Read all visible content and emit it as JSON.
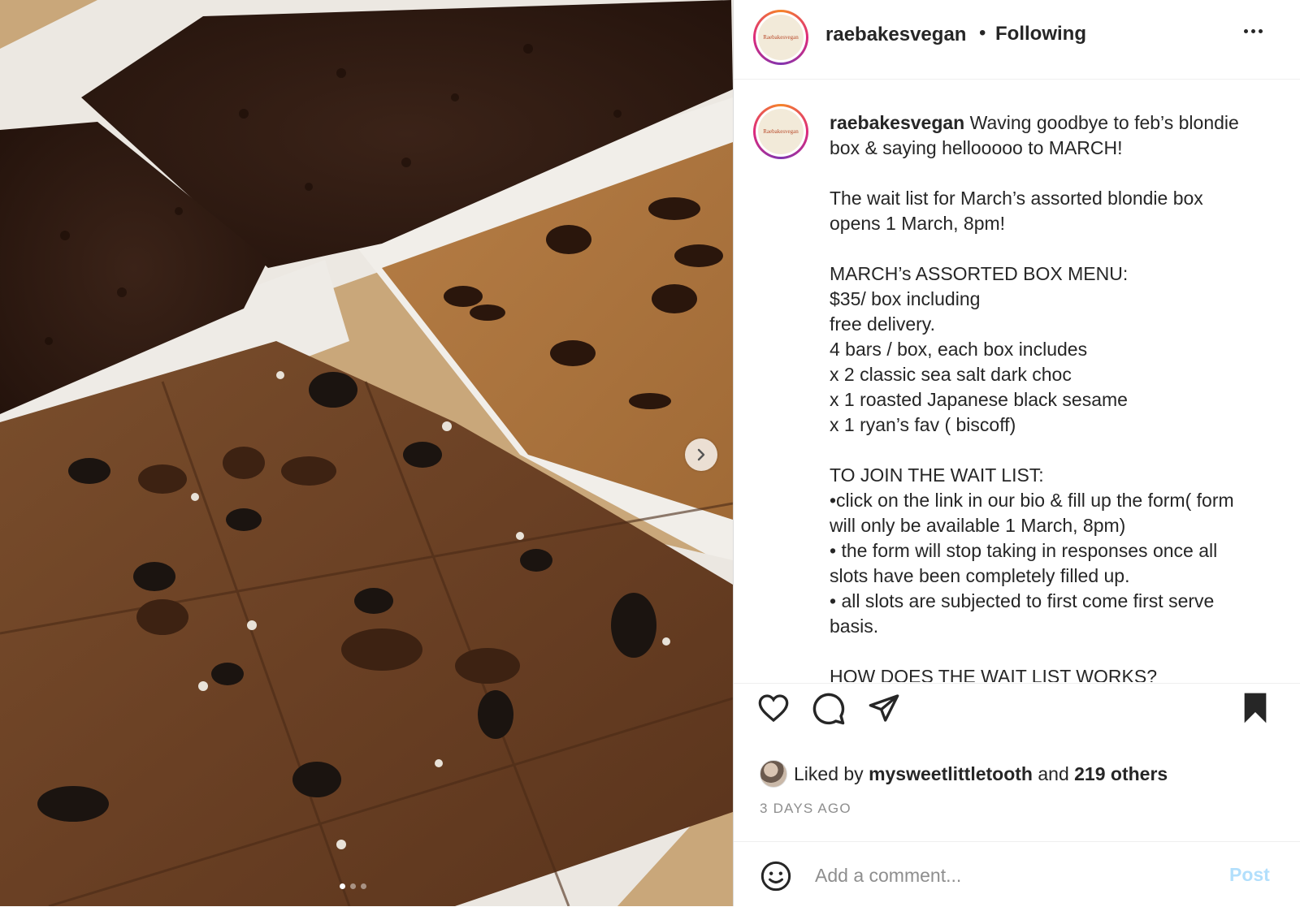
{
  "post": {
    "username": "raebakesvegan",
    "separator": "•",
    "follow_status": "Following",
    "avatar_text": "Raebakesvegan",
    "more_icon": "more-horizontal-icon"
  },
  "photo": {
    "carousel_count": 3,
    "active_index": 0,
    "next_icon": "chevron-right-icon"
  },
  "caption": {
    "username": "raebakesvegan",
    "first_line": "Waving goodbye to feb’s blondie",
    "lines": [
      "box & saying hellooooo to MARCH!",
      "",
      "The wait list for March’s assorted blondie box",
      "opens 1 March, 8pm!",
      "",
      "MARCH’s ASSORTED BOX MENU:",
      "$35/ box including",
      "free delivery.",
      "4 bars / box, each box includes",
      "x 2 classic sea salt dark choc",
      "x 1 roasted Japanese black sesame",
      "x 1 ryan’s fav ( biscoff)",
      "",
      "TO JOIN THE WAIT LIST:",
      "•click on the link in our bio & fill up the form( form",
      "will only be available 1 March, 8pm)",
      "• the form will stop taking in responses once all",
      "slots have been completely filled up.",
      "• all slots are subjected to first come first serve",
      "basis.",
      "",
      "HOW DOES THE WAIT LIST WORKS?"
    ]
  },
  "actions": {
    "like_icon": "heart-icon",
    "comment_icon": "comment-icon",
    "share_icon": "paper-plane-icon",
    "save_icon": "bookmark-icon"
  },
  "likes": {
    "prefix": "Liked by",
    "user": "mysweetlittletooth",
    "joiner": "and",
    "others": "219 others"
  },
  "timestamp": "3 DAYS AGO",
  "comment": {
    "emoji_icon": "emoji-icon",
    "placeholder": "Add a comment...",
    "post_label": "Post"
  }
}
